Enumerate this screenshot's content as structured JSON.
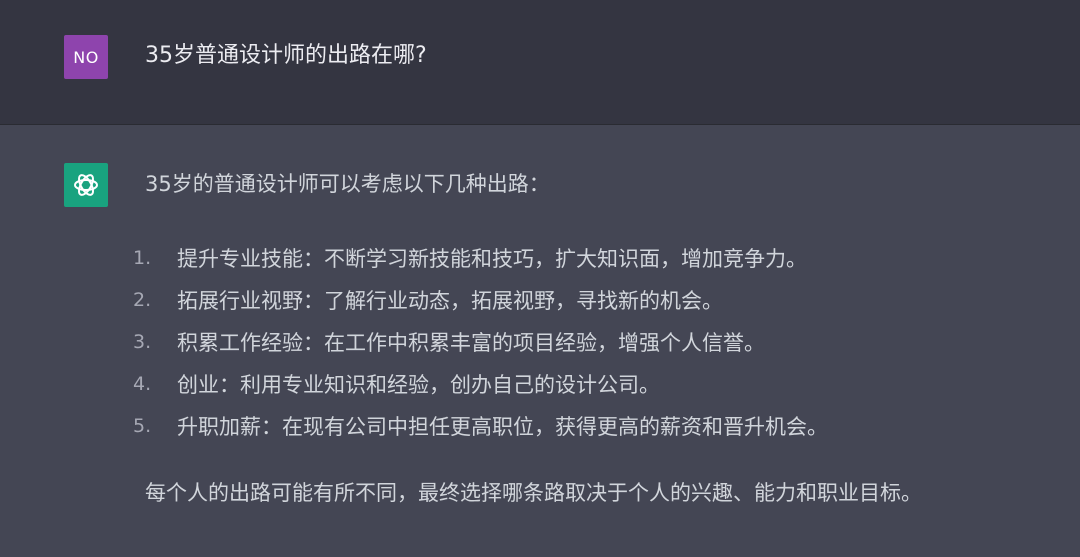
{
  "user_turn": {
    "avatar_text": "NO",
    "message": "35岁普通设计师的出路在哪?"
  },
  "assistant_turn": {
    "avatar_icon": "openai-logo-icon",
    "intro": "35岁的普通设计师可以考虑以下几种出路：",
    "items": [
      {
        "number": "1.",
        "text": "提升专业技能：不断学习新技能和技巧，扩大知识面，增加竞争力。"
      },
      {
        "number": "2.",
        "text": "拓展行业视野：了解行业动态，拓展视野，寻找新的机会。"
      },
      {
        "number": "3.",
        "text": "积累工作经验：在工作中积累丰富的项目经验，增强个人信誉。"
      },
      {
        "number": "4.",
        "text": "创业：利用专业知识和经验，创办自己的设计公司。"
      },
      {
        "number": "5.",
        "text": "升职加薪：在现有公司中担任更高职位，获得更高的薪资和晋升机会。"
      }
    ],
    "conclusion": "每个人的出路可能有所不同，最终选择哪条路取决于个人的兴趣、能力和职业目标。"
  },
  "colors": {
    "user_background": "#343541",
    "assistant_background": "#444654",
    "user_avatar": "#8e44ad",
    "assistant_avatar": "#19a37f"
  }
}
